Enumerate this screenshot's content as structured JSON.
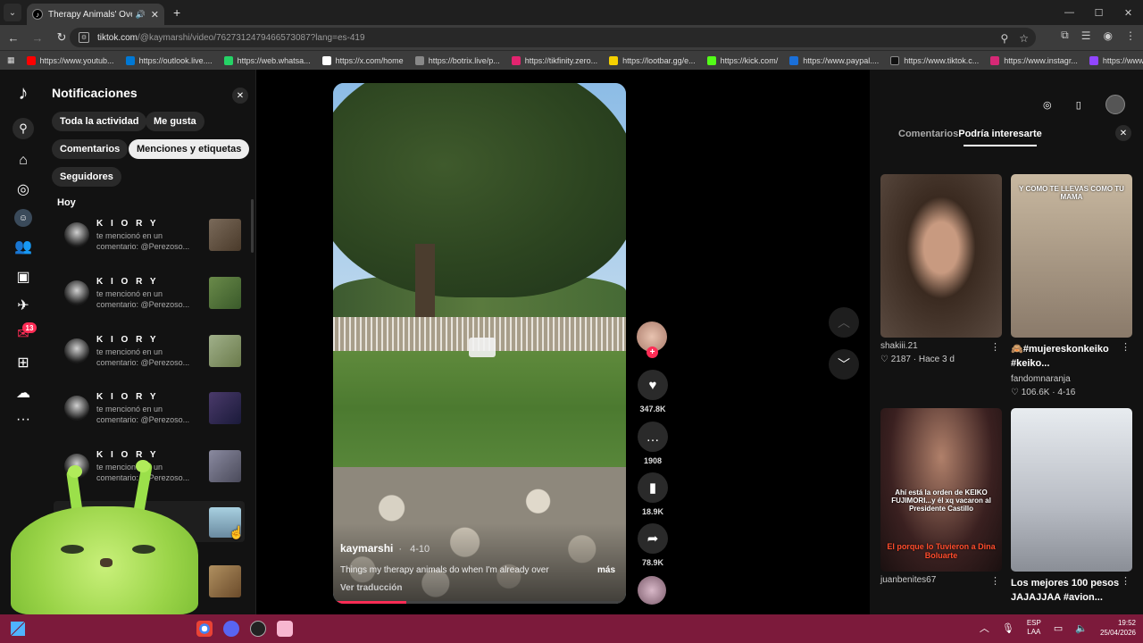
{
  "browser": {
    "tab_title": "Therapy Animals' Overstim",
    "url_domain": "tiktok.com",
    "url_path": "/@kaymarshi/video/7627312479466573087?lang=es-419",
    "bookmarks": [
      {
        "label": "https://www.youtub...",
        "color": "#ff0000"
      },
      {
        "label": "https://outlook.live....",
        "color": "#0078d4"
      },
      {
        "label": "https://web.whatsa...",
        "color": "#25d366"
      },
      {
        "label": "https://x.com/home",
        "color": "#ffffff"
      },
      {
        "label": "https://botrix.live/p...",
        "color": "#888888"
      },
      {
        "label": "https://tikfinity.zero...",
        "color": "#e2246f"
      },
      {
        "label": "https://lootbar.gg/e...",
        "color": "#f5d000"
      },
      {
        "label": "https://kick.com/",
        "color": "#53fc18"
      },
      {
        "label": "https://www.paypal....",
        "color": "#1a6fd8"
      },
      {
        "label": "https://www.tiktok.c...",
        "color": "#111111"
      },
      {
        "label": "https://www.instagr...",
        "color": "#d62976"
      },
      {
        "label": "https://www.twitch.t...",
        "color": "#9146ff"
      }
    ]
  },
  "notifications": {
    "title": "Notificaciones",
    "filters": [
      "Toda la actividad",
      "Me gusta",
      "Comentarios",
      "Menciones y etiquetas",
      "Seguidores"
    ],
    "active_filter": "Menciones y etiquetas",
    "section": "Hoy",
    "items": [
      {
        "user": "K I O R Y",
        "line1": "te mencionó en un",
        "line2": "comentario: @Perezoso...",
        "thumb": "#6a5a4a"
      },
      {
        "user": "K I O R Y",
        "line1": "te mencionó en un",
        "line2": "comentario: @Perezoso...",
        "thumb": "#4e6a3a"
      },
      {
        "user": "K I O R Y",
        "line1": "te mencionó en un",
        "line2": "comentario: @Perezoso...",
        "thumb": "#8aa06a"
      },
      {
        "user": "K I O R Y",
        "line1": "te mencionó en un",
        "line2": "comentario: @Perezoso...",
        "thumb": "#3a2a5a"
      },
      {
        "user": "K I O R Y",
        "line1": "te mencionó en un",
        "line2": "comentario: @Perezoso...",
        "thumb": "#6a6a7a"
      }
    ],
    "badge": "13"
  },
  "video": {
    "author": "kaymarshi",
    "date": "4-10",
    "caption": "Things my therapy animals do when I'm already over",
    "more": "más",
    "translate": "Ver traducción",
    "progress": 0.25
  },
  "actions": {
    "likes": "347.8K",
    "comments": "1908",
    "saves": "18.9K",
    "shares": "78.9K"
  },
  "right_panel": {
    "tab_comments": "Comentarios",
    "tab_suggested": "Podría interesarte",
    "cards": [
      {
        "caption": "",
        "user": "shakiii.21",
        "likes": "2187",
        "date": "Hace 3 d",
        "overlay": ""
      },
      {
        "caption": "🙈#mujereskonkeiko #keiko...",
        "user": "fandomnaranja",
        "likes": "106.6K",
        "date": "4-16",
        "overlay": "Y COMO TE LLEVAS COMO TU MAMA"
      },
      {
        "caption": "",
        "user": "juanbenites67",
        "likes": "",
        "date": "",
        "overlay": "Ahí está la orden de KEIKO FUJIMORI...y él xq vacaron al Presidente Castillo",
        "overlay2": "El porque lo Tuvieron a Dina Boluarte"
      },
      {
        "caption": "Los mejores 100 pesos JAJAJJAA #avion...",
        "user": "",
        "likes": "",
        "date": "",
        "overlay": ""
      }
    ]
  },
  "taskbar": {
    "lang": "ESP",
    "region": "LAA",
    "time": "19:52",
    "date": "25/04/2026"
  }
}
